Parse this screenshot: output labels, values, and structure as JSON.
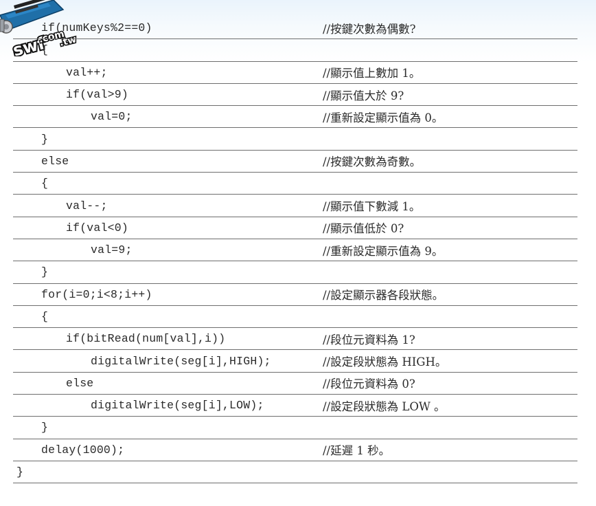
{
  "watermark": {
    "text": "swf.com.tw"
  },
  "rows": [
    {
      "indent": 1,
      "code": "if(numKeys%2==0)",
      "comment": "//按鍵次數為偶數?"
    },
    {
      "indent": 1,
      "code": "{",
      "comment": ""
    },
    {
      "indent": 2,
      "code": "val++;",
      "comment": "//顯示值上數加 1。"
    },
    {
      "indent": 2,
      "code": "if(val>9)",
      "comment": "//顯示值大於 9?"
    },
    {
      "indent": 3,
      "code": "val=0;",
      "comment": "//重新設定顯示值為 0。"
    },
    {
      "indent": 1,
      "code": "}",
      "comment": ""
    },
    {
      "indent": 1,
      "code": "else",
      "comment": "//按鍵次數為奇數。"
    },
    {
      "indent": 1,
      "code": "{",
      "comment": ""
    },
    {
      "indent": 2,
      "code": "val--;",
      "comment": "//顯示值下數減 1。"
    },
    {
      "indent": 2,
      "code": "if(val<0)",
      "comment": "//顯示值低於 0?"
    },
    {
      "indent": 3,
      "code": "val=9;",
      "comment": "//重新設定顯示值為 9。"
    },
    {
      "indent": 1,
      "code": "}",
      "comment": ""
    },
    {
      "indent": 1,
      "code": "for(i=0;i<8;i++)",
      "comment": "//設定顯示器各段狀態。"
    },
    {
      "indent": 1,
      "code": "{",
      "comment": ""
    },
    {
      "indent": 2,
      "code": "if(bitRead(num[val],i))",
      "comment": "//段位元資料為 1?"
    },
    {
      "indent": 3,
      "code": "digitalWrite(seg[i],HIGH);",
      "comment": "//設定段狀態為 HIGH。"
    },
    {
      "indent": 2,
      "code": "else",
      "comment": "//段位元資料為 0?"
    },
    {
      "indent": 3,
      "code": "digitalWrite(seg[i],LOW);",
      "comment": "//設定段狀態為 LOW 。"
    },
    {
      "indent": 1,
      "code": "}",
      "comment": ""
    },
    {
      "indent": 1,
      "code": "delay(1000);",
      "comment": "//延遲 1 秒。"
    },
    {
      "indent": 0,
      "code": "}",
      "comment": ""
    }
  ]
}
